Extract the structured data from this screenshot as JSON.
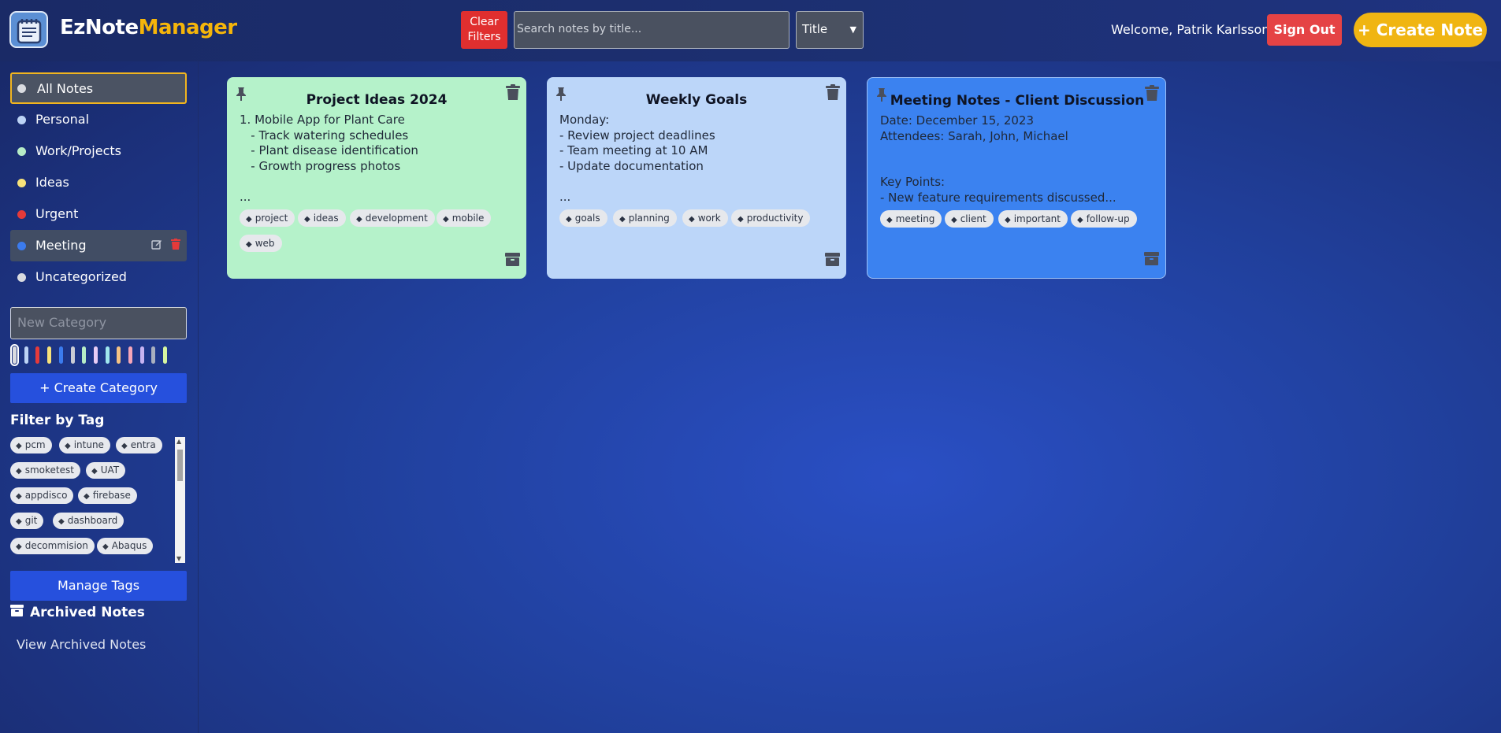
{
  "header": {
    "brand_part1": "EzNote",
    "brand_part2": "Manager",
    "clear_filters_line1": "Clear",
    "clear_filters_line2": "Filters",
    "search_placeholder": "Search notes by title...",
    "sort_selected": "Title",
    "welcome": "Welcome, Patrik Karlsson",
    "sign_out": "Sign Out",
    "create_note": "Create Note"
  },
  "colors": {
    "accent_yellow": "#f0b512",
    "danger_red": "#e54345",
    "primary_blue": "#2650dd"
  },
  "sidebar": {
    "categories": [
      {
        "label": "All Notes",
        "color": "#d9dbe0"
      },
      {
        "label": "Personal",
        "color": "#bcd3f5"
      },
      {
        "label": "Work/Projects",
        "color": "#b6ecc6"
      },
      {
        "label": "Ideas",
        "color": "#f7e27a"
      },
      {
        "label": "Urgent",
        "color": "#e53a3a"
      },
      {
        "label": "Meeting",
        "color": "#3b7bee"
      },
      {
        "label": "Uncategorized",
        "color": "#d9dbe0"
      }
    ],
    "new_category_placeholder": "New Category",
    "swatch_colors": [
      "#d9dbe0",
      "#bcd3f5",
      "#e53a3a",
      "#f7e27a",
      "#3b7bee",
      "#c9ccd4",
      "#b6ecc6",
      "#e8ccf5",
      "#9fe6ee",
      "#f5c283",
      "#f5a6b8",
      "#c7b3f2",
      "#a9b0bf",
      "#d6f5a0"
    ],
    "create_category": "Create Category",
    "filter_by_tag": "Filter by Tag",
    "tags": [
      "pcm",
      "intune",
      "entra",
      "smoketest",
      "UAT",
      "appdisco",
      "firebase",
      "git",
      "dashboard",
      "decommision",
      "Abaqus"
    ],
    "manage_tags": "Manage Tags",
    "archived_title": "Archived Notes",
    "view_archived": "View Archived Notes"
  },
  "notes": [
    {
      "title": "Project Ideas 2024",
      "body": "1. Mobile App for Plant Care\n   - Track watering schedules\n   - Plant disease identification\n   - Growth progress photos\n\n...",
      "tags": [
        "project",
        "ideas",
        "development",
        "mobile",
        "web"
      ],
      "color": "#b5f2ca"
    },
    {
      "title": "Weekly Goals",
      "body": "Monday:\n- Review project deadlines\n- Team meeting at 10 AM\n- Update documentation\n\n...",
      "tags": [
        "goals",
        "planning",
        "work",
        "productivity"
      ],
      "color": "#bcd6f9"
    },
    {
      "title": "Meeting Notes - Client Discussion",
      "body": "Date: December 15, 2023\nAttendees: Sarah, John, Michael\n\n\nKey Points:\n- New feature requirements discussed...",
      "tags": [
        "meeting",
        "client",
        "important",
        "follow-up"
      ],
      "color": "#3b82f0"
    }
  ]
}
